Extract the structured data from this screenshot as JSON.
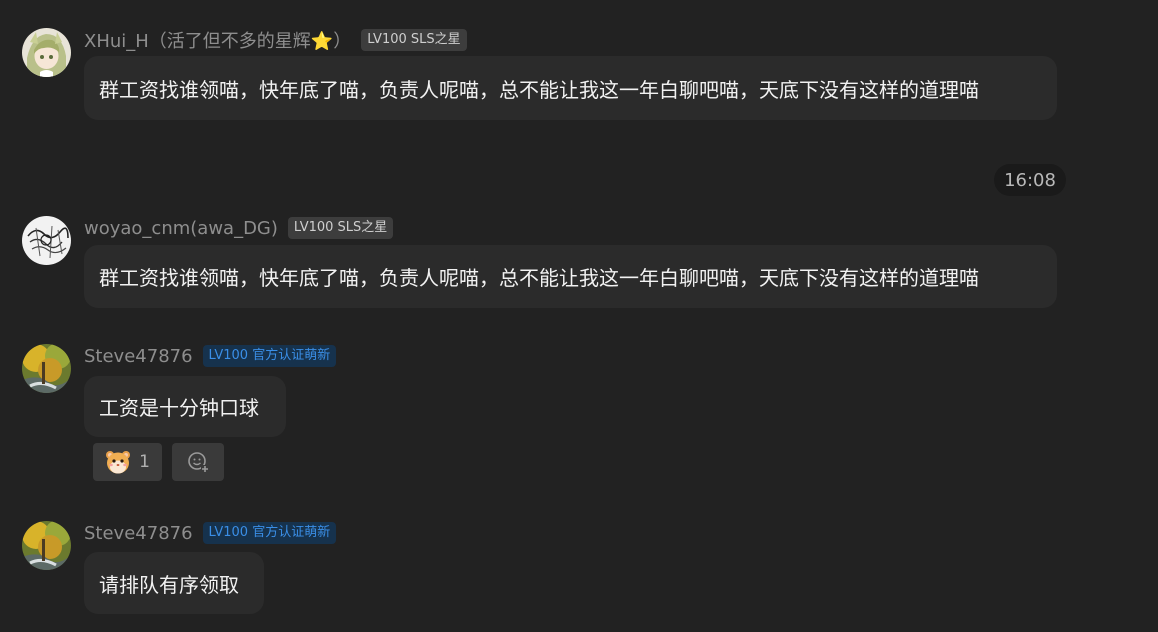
{
  "messages": [
    {
      "user": "XHui_H（活了但不多的星辉⭐）",
      "badge": "LV100 SLS之星",
      "badge_style": "gray",
      "text": "群工资找谁领喵，快年底了喵，负责人呢喵，总不能让我这一年白聊吧喵，天底下没有这样的道理喵"
    },
    {
      "user": "woyao_cnm(awa_DG)",
      "badge": "LV100 SLS之星",
      "badge_style": "gray",
      "text": "群工资找谁领喵，快年底了喵，负责人呢喵，总不能让我这一年白聊吧喵，天底下没有这样的道理喵"
    },
    {
      "user": "Steve47876",
      "badge": "LV100 官方认证萌新",
      "badge_style": "blue",
      "text": "工资是十分钟口球",
      "reactions": [
        {
          "emoji": "hamster-face-emoji",
          "count": "1"
        },
        {
          "emoji": "add-reaction-icon",
          "count": ""
        }
      ]
    },
    {
      "user": "Steve47876",
      "badge": "LV100 官方认证萌新",
      "badge_style": "blue",
      "text": "请排队有序领取"
    }
  ],
  "time_divider": "16:08",
  "colors": {
    "background": "#222222",
    "bubble": "#2b2b2b",
    "gray_badge": "#3d3d3d",
    "blue_badge_bg": "#16324d",
    "blue_badge_text": "#3a8ee6"
  }
}
